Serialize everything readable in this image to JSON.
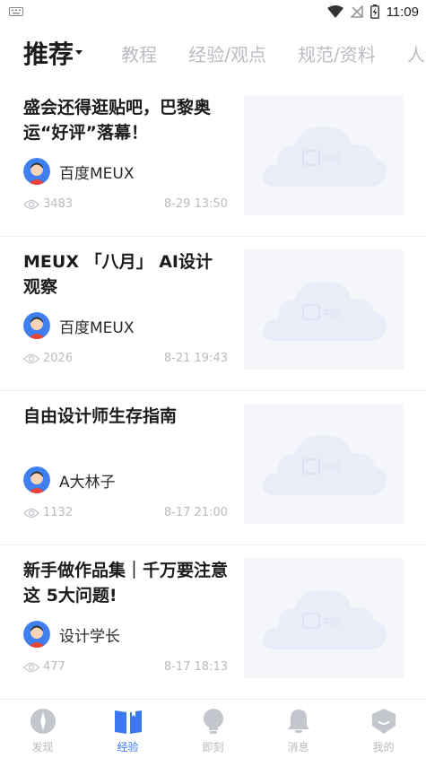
{
  "status_bar": {
    "time": "11:09"
  },
  "top_tabs": [
    {
      "label": "推荐"
    },
    {
      "label": "教程"
    },
    {
      "label": "经验/观点"
    },
    {
      "label": "规范/资料"
    },
    {
      "label": "人物"
    }
  ],
  "feed": [
    {
      "title": "盛会还得逛贴吧，巴黎奥运“好评”落幕！",
      "author": "百度MEUX",
      "views": "3483",
      "time": "8-29 13:50"
    },
    {
      "title": "MEUX 「八月」 AI设计观察",
      "author": "百度MEUX",
      "views": "2026",
      "time": "8-21 19:43"
    },
    {
      "title": "自由设计师生存指南",
      "author": "A大林子",
      "views": "1132",
      "time": "8-17 21:00"
    },
    {
      "title": "新手做作品集｜千万要注意这 5大问题!",
      "author": "设计学长",
      "views": "477",
      "time": "8-17 18:13"
    }
  ],
  "bottom_nav": [
    {
      "label": "发现",
      "icon": "compass-icon"
    },
    {
      "label": "经验",
      "icon": "book-icon"
    },
    {
      "label": "即刻",
      "icon": "lightbulb-icon"
    },
    {
      "label": "消息",
      "icon": "bell-icon"
    },
    {
      "label": "我的",
      "icon": "profile-shield-icon"
    }
  ],
  "colors": {
    "accent": "#3c78f0",
    "inactive": "#b6b9bf",
    "placeholder_bg": "#f5f6fa"
  }
}
